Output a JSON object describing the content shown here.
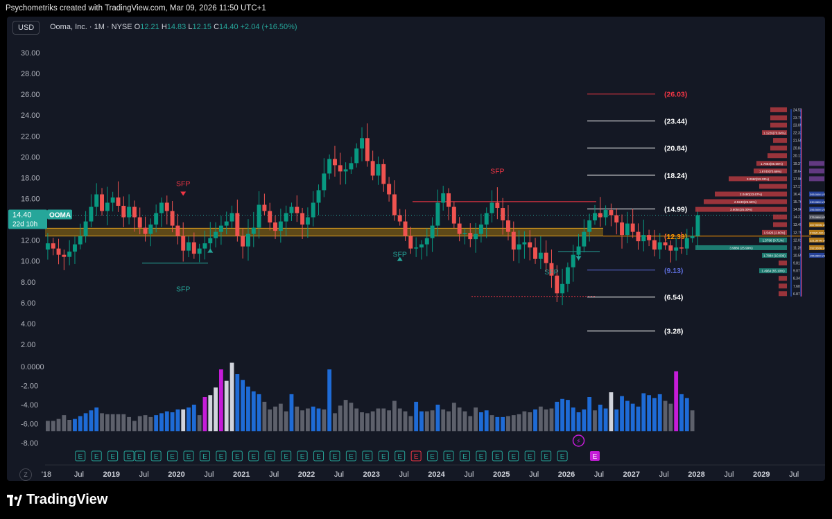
{
  "watermark": "Psychometriks created with TradingView.com, Mar 09, 2026 11:50 UTC+1",
  "brand": "TradingView",
  "header": {
    "currency": "USD",
    "symbol": "Ooma, Inc. · 1M · NYSE",
    "o_label": "O",
    "o_value": "12.21",
    "h_label": "H",
    "h_value": "14.83",
    "l_label": "L",
    "l_value": "12.15",
    "c_label": "C",
    "c_value": "14.40",
    "change": "+2.04 (+16.50%)"
  },
  "price_tag": {
    "price": "14.40",
    "ticker": "OOMA",
    "countdown": "22d 10h"
  },
  "zoom_badge": "Z",
  "colors": {
    "up": "#26a69a",
    "down": "#ef5350",
    "candle_up_body": "#089981",
    "fib_red": "#f23645",
    "fib_white": "#ffffff",
    "fib_orange": "#ff9800",
    "fib_blue": "#5b6bd6",
    "vol_blue": "#1e6bd6",
    "vol_grey": "#5d606b",
    "vol_white": "#d1d4dc",
    "vol_magenta": "#c51cd8",
    "zone": "#b8860b"
  },
  "chart_data": [
    {
      "type": "candlestick",
      "interval": "1M",
      "price_axis": {
        "min": 1.0,
        "max": 31.0,
        "ticks": [
          "30.00",
          "28.00",
          "26.00",
          "24.00",
          "22.00",
          "20.00",
          "18.00",
          "16.00",
          "14.00",
          "12.00",
          "10.00",
          "8.00",
          "6.00",
          "4.00",
          "2.00"
        ]
      },
      "time_axis": {
        "start": "2018-01",
        "end": "2029-12",
        "labels": [
          {
            "t": "2018-01",
            "label": "'18"
          },
          {
            "t": "2018-07",
            "label": "Jul"
          },
          {
            "t": "2019-01",
            "label": "2019"
          },
          {
            "t": "2019-07",
            "label": "Jul"
          },
          {
            "t": "2020-01",
            "label": "2020"
          },
          {
            "t": "2020-07",
            "label": "Jul"
          },
          {
            "t": "2021-01",
            "label": "2021"
          },
          {
            "t": "2021-07",
            "label": "Jul"
          },
          {
            "t": "2022-01",
            "label": "2022"
          },
          {
            "t": "2022-07",
            "label": "Jul"
          },
          {
            "t": "2023-01",
            "label": "2023"
          },
          {
            "t": "2023-07",
            "label": "Jul"
          },
          {
            "t": "2024-01",
            "label": "2024"
          },
          {
            "t": "2024-07",
            "label": "Jul"
          },
          {
            "t": "2025-01",
            "label": "2025"
          },
          {
            "t": "2025-07",
            "label": "Jul"
          },
          {
            "t": "2026-01",
            "label": "2026"
          },
          {
            "t": "2026-07",
            "label": "Jul"
          },
          {
            "t": "2027-01",
            "label": "2027"
          },
          {
            "t": "2027-07",
            "label": "Jul"
          },
          {
            "t": "2028-01",
            "label": "2028"
          },
          {
            "t": "2028-07",
            "label": "Jul"
          },
          {
            "t": "2029-01",
            "label": "2029"
          },
          {
            "t": "2029-07",
            "label": "Jul"
          }
        ]
      },
      "close": [
        11.7,
        11.2,
        10.6,
        10.4,
        10.9,
        11.6,
        12.4,
        13.8,
        15.2,
        16.4,
        14.8,
        15.6,
        16.1,
        15.3,
        14.2,
        15.2,
        14.2,
        13.2,
        12.6,
        13.5,
        14.6,
        15.6,
        14.8,
        13.4,
        12.4,
        11.0,
        11.8,
        10.7,
        11.2,
        11.7,
        12.2,
        12.8,
        13.4,
        13.8,
        14.6,
        12.4,
        11.4,
        12.6,
        13.2,
        15.4,
        14.8,
        13.7,
        12.9,
        13.8,
        14.6,
        15.2,
        14.6,
        13.5,
        14.2,
        15.6,
        16.8,
        18.4,
        19.8,
        19.2,
        18.6,
        18.8,
        19.4,
        20.8,
        21.8,
        19.6,
        18.2,
        19.3,
        17.4,
        16.4,
        14.4,
        13.8,
        12.4,
        11.2,
        11.3,
        11.6,
        12.2,
        13.4,
        15.6,
        16.5,
        15.2,
        13.6,
        12.6,
        12.7,
        12.1,
        12.6,
        13.5,
        14.6,
        15.6,
        15.1,
        13.9,
        12.8,
        11.1,
        11.6,
        11.8,
        11.3,
        10.2,
        10.8,
        9.8,
        8.6,
        6.9,
        7.8,
        9.4,
        10.6,
        11.4,
        12.8,
        13.9,
        14.6,
        14.2,
        14.9,
        14.4,
        13.7,
        12.5,
        13.6,
        12.8,
        11.9,
        12.5,
        12.0,
        11.1,
        11.8,
        11.5,
        11.0,
        11.3,
        11.2,
        12.2,
        12.4,
        14.4
      ],
      "volume_axis": {
        "ticks": [
          "0.0000",
          "-2.00",
          "-4.00",
          "-6.00",
          "-8.00"
        ]
      },
      "volume": [
        -5.7,
        -5.7,
        -5.5,
        -5.1,
        -5.6,
        -5.5,
        -5.2,
        -4.9,
        -4.6,
        -4.3,
        -4.9,
        -5.0,
        -5.0,
        -5.0,
        -5.0,
        -5.3,
        -5.7,
        -5.2,
        -5.1,
        -5.3,
        -5.1,
        -4.9,
        -4.7,
        -4.8,
        -4.5,
        -4.5,
        -4.3,
        -4.0,
        -5.1,
        -3.2,
        -3.0,
        -2.2,
        -0.3,
        -1.5,
        0.4,
        -0.8,
        -1.4,
        -2.1,
        -2.6,
        -2.9,
        -3.7,
        -4.5,
        -4.2,
        -3.9,
        -4.7,
        -2.9,
        -4.2,
        -4.6,
        -4.4,
        -4.2,
        -4.4,
        -4.5,
        -0.3,
        -4.9,
        -4.1,
        -3.5,
        -3.8,
        -4.4,
        -4.8,
        -4.9,
        -4.7,
        -4.4,
        -4.4,
        -4.6,
        -3.6,
        -4.4,
        -4.7,
        -5.2,
        -3.7,
        -4.7,
        -4.7,
        -4.6,
        -4.0,
        -4.5,
        -4.7,
        -3.8,
        -4.3,
        -4.7,
        -5.2,
        -4.3,
        -4.8,
        -4.6,
        -5.1,
        -5.3,
        -5.3,
        -5.2,
        -5.1,
        -5.0,
        -4.7,
        -4.8,
        -4.5,
        -4.2,
        -4.5,
        -4.4,
        -3.7,
        -3.4,
        -3.5,
        -4.3,
        -4.8,
        -4.5,
        -3.2,
        -4.6,
        -4.0,
        -4.4,
        -2.7,
        -4.5,
        -3.1,
        -3.6,
        -3.9,
        -4.2,
        -2.8,
        -3.0,
        -3.3,
        -2.9,
        -3.6,
        -3.9,
        -0.5,
        -2.9,
        -3.3,
        -4.6
      ],
      "volume_color": [
        "grey",
        "grey",
        "grey",
        "grey",
        "grey",
        "blue",
        "blue",
        "blue",
        "blue",
        "blue",
        "grey",
        "grey",
        "grey",
        "grey",
        "grey",
        "grey",
        "grey",
        "grey",
        "grey",
        "grey",
        "blue",
        "blue",
        "blue",
        "blue",
        "blue",
        "white",
        "blue",
        "blue",
        "grey",
        "magenta",
        "white",
        "white",
        "magenta",
        "white",
        "white",
        "blue",
        "blue",
        "blue",
        "blue",
        "blue",
        "grey",
        "grey",
        "grey",
        "grey",
        "grey",
        "blue",
        "grey",
        "grey",
        "grey",
        "blue",
        "blue",
        "grey",
        "blue",
        "grey",
        "grey",
        "grey",
        "grey",
        "grey",
        "grey",
        "grey",
        "grey",
        "grey",
        "grey",
        "grey",
        "grey",
        "grey",
        "grey",
        "grey",
        "blue",
        "blue",
        "grey",
        "grey",
        "blue",
        "grey",
        "grey",
        "grey",
        "grey",
        "grey",
        "grey",
        "grey",
        "blue",
        "blue",
        "grey",
        "blue",
        "blue",
        "grey",
        "grey",
        "grey",
        "grey",
        "grey",
        "blue",
        "grey",
        "grey",
        "grey",
        "blue",
        "blue",
        "blue",
        "blue",
        "blue",
        "blue",
        "blue",
        "grey",
        "blue",
        "blue",
        "white",
        "blue",
        "blue",
        "blue",
        "blue",
        "blue",
        "blue",
        "blue",
        "blue",
        "blue",
        "grey",
        "grey",
        "magenta",
        "blue",
        "blue",
        "grey"
      ],
      "fib_levels": [
        {
          "price": 26.03,
          "label": "(26.03)",
          "color": "red"
        },
        {
          "price": 23.44,
          "label": "(23.44)",
          "color": "white"
        },
        {
          "price": 20.84,
          "label": "(20.84)",
          "color": "white"
        },
        {
          "price": 18.24,
          "label": "(18.24)",
          "color": "white"
        },
        {
          "price": 14.99,
          "label": "(14.99)",
          "color": "white"
        },
        {
          "price": 12.39,
          "label": "(12.39)",
          "color": "orange"
        },
        {
          "price": 9.13,
          "label": "(9.13)",
          "color": "blue"
        },
        {
          "price": 6.54,
          "label": "(6.54)",
          "color": "white"
        },
        {
          "price": 3.28,
          "label": "(3.28)",
          "color": "white"
        }
      ],
      "sfp_markers": [
        {
          "t": "2020-02",
          "price": 17.2,
          "label": "SFP",
          "color": "red",
          "shape": "down"
        },
        {
          "t": "2020-02",
          "price": 7.1,
          "label": "SFP",
          "color": "green",
          "shape": "none"
        },
        {
          "t": "2020-07",
          "price": 11.2,
          "label": "",
          "color": "green",
          "shape": "up"
        },
        {
          "t": "2023-06",
          "price": 10.4,
          "label": "SFP",
          "color": "green",
          "shape": "up"
        },
        {
          "t": "2024-12",
          "price": 18.4,
          "label": "SFP",
          "color": "red",
          "shape": "none"
        },
        {
          "t": "2025-10",
          "price": 8.7,
          "label": "SFP",
          "color": "green",
          "shape": "none"
        },
        {
          "t": "2026-03",
          "price": 11.0,
          "label": "",
          "color": "green",
          "shape": "down"
        }
      ],
      "earnings_markers": {
        "months": [
          "2018-07",
          "2018-10",
          "2019-01",
          "2019-04",
          "2019-06",
          "2019-09",
          "2019-12",
          "2020-03",
          "2020-06",
          "2020-09",
          "2020-12",
          "2021-03",
          "2021-06",
          "2021-09",
          "2021-12",
          "2022-03",
          "2022-06",
          "2022-09",
          "2022-12",
          "2023-03",
          "2023-06",
          "2023-09",
          "2023-12",
          "2024-03",
          "2024-06",
          "2024-09",
          "2024-12",
          "2025-03",
          "2025-06",
          "2025-09",
          "2025-12"
        ],
        "label": "E",
        "highlight": [
          "2023-09",
          "2026-06"
        ]
      },
      "volume_profile": {
        "rows": [
          {
            "price": "24.52",
            "bar": "",
            "w": 0.12,
            "tint": "red"
          },
          {
            "price": "23.75",
            "bar": "",
            "w": 0.12,
            "tint": "red"
          },
          {
            "price": "23.05",
            "bar": "",
            "w": 0.12,
            "tint": "red"
          },
          {
            "price": "22.32",
            "bar": "1.1226(70.04%)",
            "w": 0.18,
            "tint": "red"
          },
          {
            "price": "21.58",
            "bar": "",
            "w": 0.1,
            "tint": "red"
          },
          {
            "price": "20.84",
            "bar": "",
            "w": 0.12,
            "tint": "red"
          },
          {
            "price": "20.11",
            "bar": "",
            "w": 0.14,
            "tint": "red"
          },
          {
            "price": "19.37",
            "bar": "1.7884(85.55%)",
            "w": 0.22,
            "tint": "red"
          },
          {
            "price": "18.64",
            "bar": "1.6740(70.66%)",
            "w": 0.24,
            "tint": "red"
          },
          {
            "price": "17.90",
            "bar": "3.0960(93.33%)",
            "w": 0.42,
            "tint": "red"
          },
          {
            "price": "17.17",
            "bar": "",
            "w": 0.2,
            "tint": "red"
          },
          {
            "price": "16.43",
            "bar": "2.0480(23.67%)",
            "w": 0.52,
            "tint": "red"
          },
          {
            "price": "15.70",
            "bar": "2.9240(26.56%)",
            "w": 0.6,
            "tint": "red"
          },
          {
            "price": "14.96",
            "bar": "3.6054(25.00%)",
            "w": 0.66,
            "tint": "red"
          },
          {
            "price": "14.23",
            "bar": "",
            "w": 0.1,
            "tint": "red"
          },
          {
            "price": "13.49",
            "bar": "",
            "w": 0.1,
            "tint": "red"
          },
          {
            "price": "12.75",
            "bar": "1.5426 (2.80%)",
            "w": 0.18,
            "tint": "red"
          },
          {
            "price": "12.02",
            "bar": "1.5796 (0.71%)",
            "w": 0.2,
            "tint": "teal"
          },
          {
            "price": "11.28",
            "bar": "3.9886 (25.99%)",
            "w": 0.66,
            "tint": "teal"
          },
          {
            "price": "10.55",
            "bar": "1.7884 (10.006)",
            "w": 0.18,
            "tint": "teal"
          },
          {
            "price": "9.81",
            "bar": "",
            "w": 0.06,
            "tint": "red"
          },
          {
            "price": "9.07",
            "bar": "1.4964 (55.10%)",
            "w": 0.2,
            "tint": "teal"
          },
          {
            "price": "8.34",
            "bar": "",
            "w": 0.06,
            "tint": "red"
          },
          {
            "price": "7.60",
            "bar": "",
            "w": 0.06,
            "tint": "red"
          },
          {
            "price": "6.87",
            "bar": "",
            "w": 0.06,
            "tint": "red"
          }
        ],
        "right_rows": [
          {
            "price": "19.37",
            "text": "",
            "tint": "purple"
          },
          {
            "price": "18.64",
            "text": "",
            "tint": "purple"
          },
          {
            "price": "17.90",
            "text": "",
            "tint": "purple"
          },
          {
            "price": "16.43",
            "text": "395.04M USD (8%)",
            "tint": "blue"
          },
          {
            "price": "15.70",
            "text": "230.06M USD (8%)",
            "tint": "blue"
          },
          {
            "price": "14.96",
            "text": "256.54M USD (8%)",
            "tint": "blue"
          },
          {
            "price": "14.23",
            "text": "275.06M USD (8%)",
            "tint": "grey"
          },
          {
            "price": "13.49",
            "text": "267.900M USD (8%)",
            "tint": "orange"
          },
          {
            "price": "12.75",
            "text": "274M USD (8%)",
            "tint": "orange"
          },
          {
            "price": "12.02",
            "text": "221.307M USD (8%)",
            "tint": "orange"
          },
          {
            "price": "11.28",
            "text": "292.320M USD (8%)",
            "tint": "orange"
          },
          {
            "price": "10.55",
            "text": "155.96M USD (8%)",
            "tint": "blue"
          }
        ]
      }
    }
  ]
}
